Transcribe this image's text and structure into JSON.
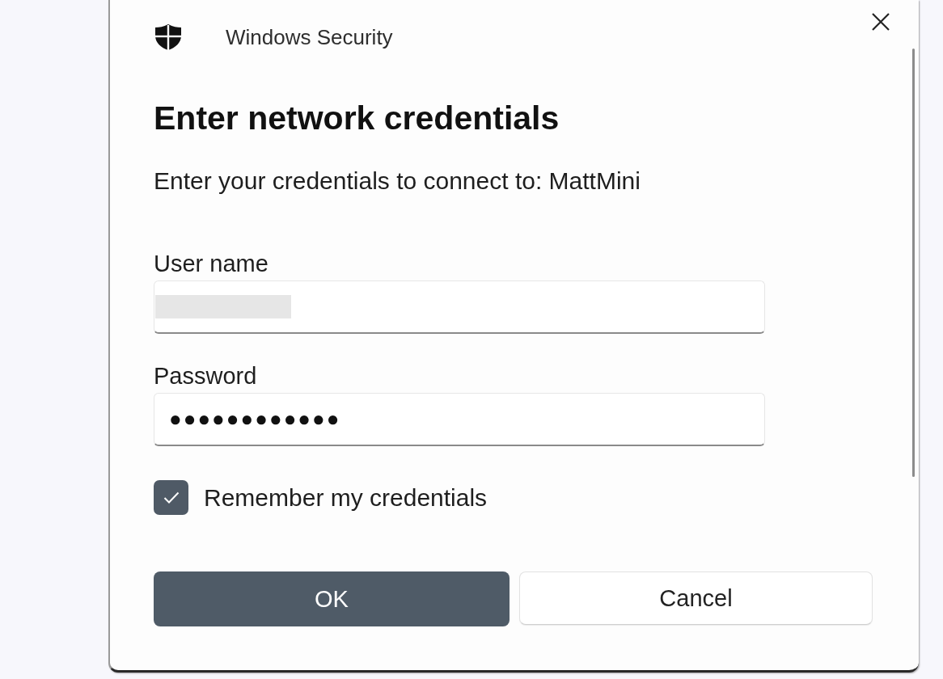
{
  "window": {
    "title": "Windows Security"
  },
  "heading": "Enter network credentials",
  "message": "Enter your credentials to connect to: MattMini",
  "fields": [
    {
      "label": "User name",
      "kind": "redacted"
    },
    {
      "label": "Password",
      "kind": "text",
      "value": "●●●●●●●●●●●●"
    }
  ],
  "remember": {
    "label": "Remember my credentials",
    "checked": true
  },
  "buttons": [
    {
      "label": "OK",
      "kind": "primary"
    },
    {
      "label": "Cancel",
      "kind": "secondary"
    }
  ]
}
